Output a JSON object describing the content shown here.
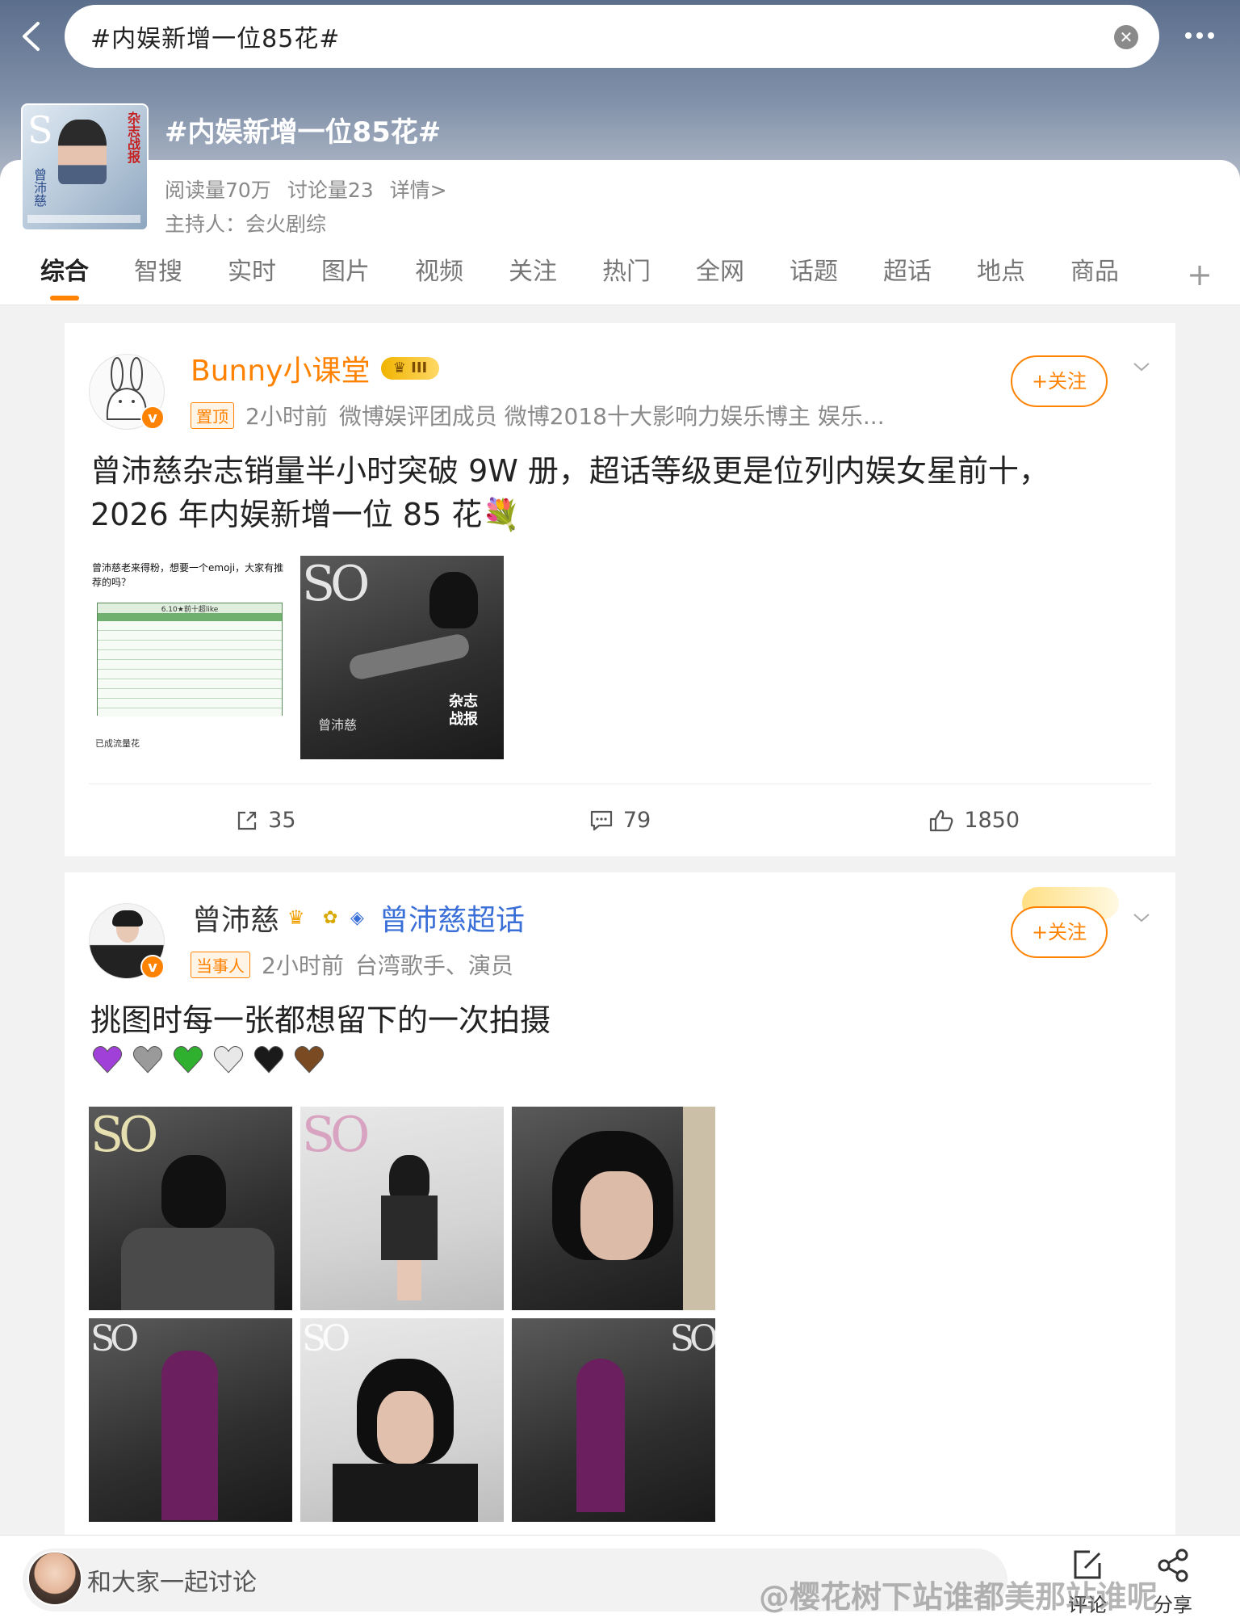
{
  "search": {
    "query": "#内娱新增一位85花#"
  },
  "topic": {
    "title": "#内娱新增一位85花#",
    "reads": "阅读量70万",
    "discussions": "讨论量23",
    "details": "详情>",
    "host": "主持人：会火剧综",
    "cover_text": "杂志战报",
    "cover_name": "曾沛慈"
  },
  "tabs": [
    "综合",
    "智搜",
    "实时",
    "图片",
    "视频",
    "关注",
    "热门",
    "全网",
    "话题",
    "超话",
    "地点",
    "商品"
  ],
  "posts": [
    {
      "username": "Bunny小课堂",
      "crown_level": "III",
      "tag": "置顶",
      "time": "2小时前",
      "bio": "微博娱评团成员 微博2018十大影响力娱乐博主 娱乐...",
      "follow": "+关注",
      "text": "曾沛慈杂志销量半小时突破 9W 册，超话等级更是位列内娱女星前十，2026 年内娱新增一位 85 花💐",
      "image1": {
        "header": "曾沛慈老来得粉，想要一个emoji，大家有推荐的吗？",
        "table_title": "6.10★前十超like",
        "footer": "已成流量花"
      },
      "image2": {
        "caption_left": "曾沛慈",
        "caption_right": "杂志战报"
      },
      "reposts": "35",
      "comments": "79",
      "likes": "1850"
    },
    {
      "username": "曾沛慈",
      "supertopic": "曾沛慈超话",
      "tag": "当事人",
      "time": "2小时前",
      "bio": "台湾歌手、演员",
      "follow": "+关注",
      "text": "挑图时每一张都想留下的一次拍摄",
      "heart_colors": [
        "#a040d8",
        "#9a9a9a",
        "#2fb12f",
        "#e8e8e8",
        "#1a1a1a",
        "#7a4a22"
      ]
    }
  ],
  "bottom": {
    "comment_placeholder": "和大家一起讨论",
    "comment_label": "评论",
    "share_label": "分享",
    "watermark": "@樱花树下站谁都美那站谁呢"
  },
  "colors": {
    "accent": "#ff8200"
  }
}
